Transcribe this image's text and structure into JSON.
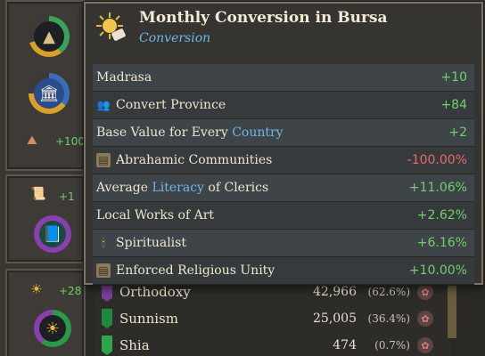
{
  "tooltip": {
    "title": "Monthly Conversion in Bursa",
    "subtitle": "Conversion",
    "modifiers": [
      {
        "label": "Madrasa",
        "value": "+10",
        "sign": "pos",
        "icon": ""
      },
      {
        "label": "Convert Province",
        "value": "+84",
        "sign": "pos",
        "icon": "people-icon"
      },
      {
        "label_pre": "Base Value for Every ",
        "label_link": "Country",
        "label_post": "",
        "value": "+2",
        "sign": "pos",
        "icon": ""
      },
      {
        "label": "Abrahamic Communities",
        "value": "-100.00%",
        "sign": "neg",
        "icon": "scroll-icon"
      },
      {
        "label_pre": "Average ",
        "label_link": "Literacy",
        "label_post": " of Clerics",
        "value": "+11.06%",
        "sign": "pos",
        "icon": ""
      },
      {
        "label": "Local Works of Art",
        "value": "+2.62%",
        "sign": "pos",
        "icon": ""
      },
      {
        "label": "Spiritualist",
        "value": "+6.16%",
        "sign": "pos",
        "icon": "candle-icon"
      },
      {
        "label": "Enforced Religious Unity",
        "value": "+10.00%",
        "sign": "pos",
        "icon": "scroll-icon"
      }
    ]
  },
  "left_panel": {
    "stat1": "+100",
    "stat2": "+1",
    "stat3": "+28"
  },
  "religions": [
    {
      "name": "Orthodoxy",
      "count": "42,966",
      "pct": "(62.6%)",
      "color": "#7a3f9a"
    },
    {
      "name": "Sunnism",
      "count": "25,005",
      "pct": "(36.4%)",
      "color": "#1f8a3c"
    },
    {
      "name": "Shia",
      "count": "474",
      "pct": "(0.7%)",
      "color": "#2ea64a"
    }
  ],
  "colors": {
    "positive": "#6fd06a",
    "negative": "#e56a6a",
    "link": "#6fb8e6"
  }
}
